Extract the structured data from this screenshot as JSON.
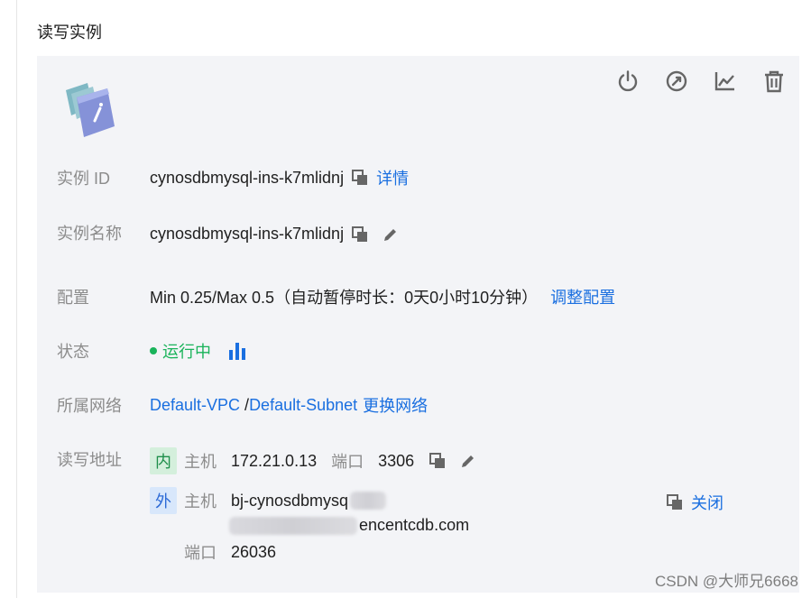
{
  "section": {
    "title": "读写实例"
  },
  "toolbar": {
    "icons": [
      "power-icon",
      "restart-icon",
      "monitor-chart-icon",
      "trash-icon"
    ],
    "color": "#666666"
  },
  "rows": {
    "instance_id": {
      "label": "实例 ID",
      "value": "cynosdbmysql-ins-k7mlidnj",
      "link": "详情"
    },
    "instance_name": {
      "label": "实例名称",
      "value": "cynosdbmysql-ins-k7mlidnj"
    },
    "config": {
      "label": "配置",
      "value": "Min 0.25/Max 0.5（自动暂停时长：0天0小时10分钟）",
      "link": "调整配置"
    },
    "status": {
      "label": "状态",
      "value": "运行中"
    },
    "network": {
      "label": "所属网络",
      "vpc": "Default-VPC",
      "sep": " /",
      "subnet": "Default-Subnet",
      "change": "更换网络"
    },
    "address": {
      "label": "读写地址",
      "internal": {
        "badge": "内",
        "host_label": "主机",
        "host": "172.21.0.13",
        "port_label": "端口",
        "port": "3306"
      },
      "external": {
        "badge": "外",
        "host_label": "主机",
        "host_start": "bj-cynosdbmysq",
        "host_end": "encentcdb.com",
        "close": "关闭",
        "port_label": "端口",
        "port": "26036"
      }
    }
  },
  "watermark": "CSDN @大师兄6668",
  "colors": {
    "link": "#1a6fe0",
    "success": "#19b35a",
    "label": "#8c8c8c",
    "card_bg": "#f3f4f7"
  }
}
